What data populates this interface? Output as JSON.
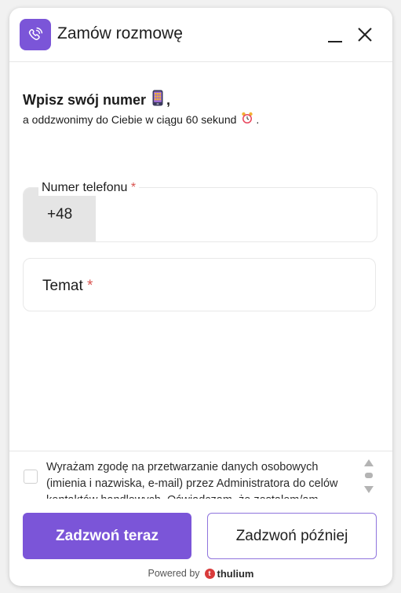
{
  "header": {
    "title": "Zamów rozmowę",
    "icon": "phone-ringing-icon",
    "accent": "#7b55d8"
  },
  "intro": {
    "heading": "Wpisz swój numer",
    "heading_suffix": ",",
    "heading_icon": "mobile-phone-icon",
    "subtext": "a oddzwonimy do Ciebie w ciągu 60 sekund",
    "subtext_suffix": ".",
    "subtext_icon": "alarm-clock-icon"
  },
  "phone": {
    "label": "Numer telefonu",
    "required_mark": "*",
    "prefix": "+48",
    "value": ""
  },
  "topic": {
    "label": "Temat",
    "required_mark": "*"
  },
  "consent": {
    "checked": false,
    "text": "Wyrażam zgodę na przetwarzanie danych osobowych (imienia i nazwiska, e-mail) przez Administratora do celów kontaktów handlowych. Oświadczam, że zostałem/am poinformowany/a"
  },
  "buttons": {
    "call_now": "Zadzwoń teraz",
    "call_later": "Zadzwoń później"
  },
  "footer": {
    "powered_by": "Powered by",
    "brand": "thulium",
    "brand_color": "#d93b3b"
  }
}
